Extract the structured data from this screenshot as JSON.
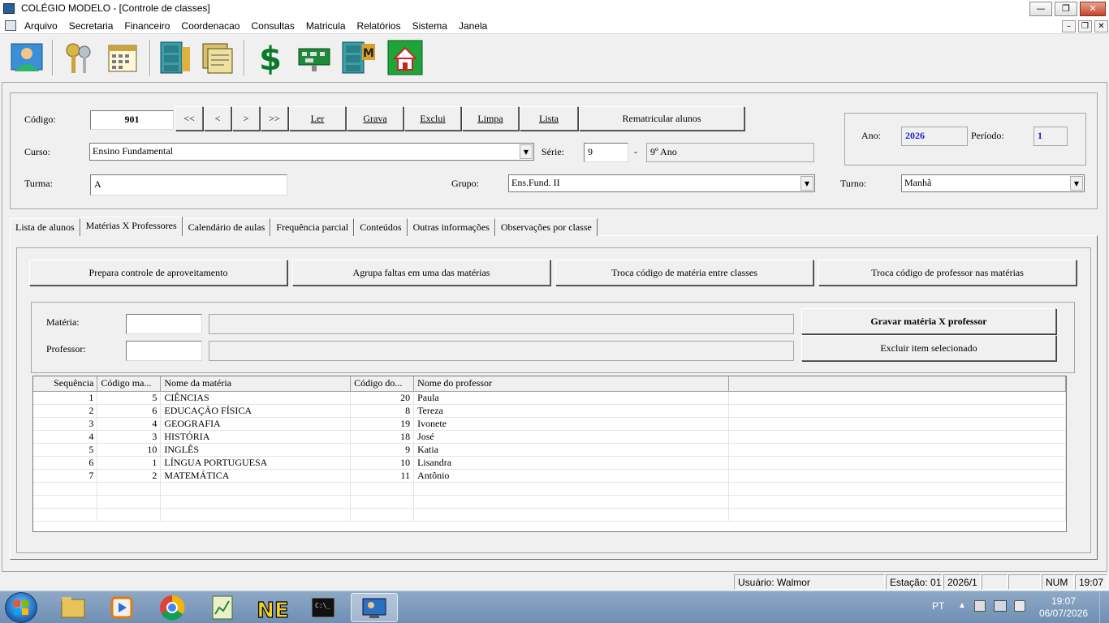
{
  "window": {
    "title": "COLÉGIO MODELO - [Controle de classes]"
  },
  "menu": [
    "Arquivo",
    "Secretaria",
    "Financeiro",
    "Coordenacao",
    "Consultas",
    "Matricula",
    "Relatórios",
    "Sistema",
    "Janela"
  ],
  "toolbar": {
    "icons": [
      "user-icon",
      "keys-icon",
      "calendar-icon",
      "filing-cabinet-icon",
      "documents-icon",
      "dollar-icon",
      "circuit-board-icon",
      "filing-cabinet-m-icon",
      "home-icon"
    ]
  },
  "header": {
    "codigo_label": "Código:",
    "codigo_value": "901",
    "nav": [
      "<<",
      "<",
      ">",
      ">>"
    ],
    "actions": [
      "Ler",
      "Grava",
      "Exclui",
      "Limpa",
      "Lista"
    ],
    "rematricular": "Rematricular alunos",
    "curso_label": "Curso:",
    "curso_value": "Ensino Fundamental",
    "serie_label": "Série:",
    "serie_value": "9",
    "serie_dash": "-",
    "serie_desc": "9º Ano",
    "turma_label": "Turma:",
    "turma_value": "A",
    "grupo_label": "Grupo:",
    "grupo_value": "Ens.Fund. II",
    "turno_label": "Turno:",
    "turno_value": "Manhã",
    "ano_label": "Ano:",
    "ano_value": "2026",
    "periodo_label": "Período:",
    "periodo_value": "1",
    "accent_color": "#1f1fd2"
  },
  "tabs": [
    "Lista de alunos",
    "Matérias X Professores",
    "Calendário de aulas",
    "Frequência parcial",
    "Conteúdos",
    "Outras informações",
    "Observações por classe"
  ],
  "active_tab": 1,
  "page": {
    "top_buttons": [
      "Prepara controle de aproveitamento",
      "Agrupa faltas em uma das matérias",
      "Troca código de matéria entre classes",
      "Troca código de professor nas matérias"
    ],
    "materia_label": "Matéria:",
    "professor_label": "Professor:",
    "gravar": "Gravar matéria X professor",
    "excluir": "Excluir item selecionado"
  },
  "grid": {
    "columns": [
      "Sequência",
      "Código ma...",
      "Nome da matéria",
      "Código do...",
      "Nome do professor"
    ],
    "rows": [
      [
        "1",
        "5",
        "CIÊNCIAS",
        "20",
        "Paula"
      ],
      [
        "2",
        "6",
        "EDUCAÇÃO FÍSICA",
        "8",
        "Tereza"
      ],
      [
        "3",
        "4",
        "GEOGRAFIA",
        "19",
        "Ivonete"
      ],
      [
        "4",
        "3",
        "HISTÓRIA",
        "18",
        "José"
      ],
      [
        "5",
        "10",
        "INGLÊS",
        "9",
        "Katia"
      ],
      [
        "6",
        "1",
        "LÍNGUA PORTUGUESA",
        "10",
        "Lisandra"
      ],
      [
        "7",
        "2",
        "MATEMÁTICA",
        "11",
        "Antônio"
      ]
    ]
  },
  "status": {
    "usuario": "Usuário: Walmor",
    "estacao": "Estação: 01",
    "periodo": "2026/1",
    "num": "NUM",
    "time": "19:07"
  },
  "taskbar": {
    "lang": "PT",
    "time": "19:07",
    "date": "06/07/2026"
  }
}
